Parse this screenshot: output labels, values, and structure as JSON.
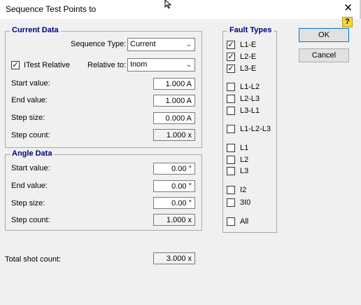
{
  "window": {
    "title": "Sequence Test Points to"
  },
  "current_data": {
    "title": "Current Data",
    "sequence_type_label": "Sequence Type:",
    "sequence_type_value": "Current",
    "itest_relative_label": "ITest Relative",
    "itest_relative_checked": true,
    "relative_to_label": "Relative to:",
    "relative_to_value": "Inom",
    "start_label": "Start value:",
    "start_value": "1.000 A",
    "end_label": "End value:",
    "end_value": "1.000 A",
    "step_size_label": "Step size:",
    "step_size_value": "0.000 A",
    "step_count_label": "Step count:",
    "step_count_value": "1.000 x"
  },
  "angle_data": {
    "title": "Angle Data",
    "start_label": "Start value:",
    "start_value": "0.00 °",
    "end_label": "End value:",
    "end_value": "0.00 °",
    "step_size_label": "Step size:",
    "step_size_value": "0.00 °",
    "step_count_label": "Step count:",
    "step_count_value": "1.000 x"
  },
  "total": {
    "label": "Total shot count:",
    "value": "3.000 x"
  },
  "fault_types": {
    "title": "Fault Types",
    "items": [
      {
        "label": "L1-E",
        "checked": true
      },
      {
        "label": "L2-E",
        "checked": true
      },
      {
        "label": "L3-E",
        "checked": true
      },
      {
        "label": "L1-L2",
        "checked": false
      },
      {
        "label": "L2-L3",
        "checked": false
      },
      {
        "label": "L3-L1",
        "checked": false
      },
      {
        "label": "L1-L2-L3",
        "checked": false
      },
      {
        "label": "L1",
        "checked": false
      },
      {
        "label": "L2",
        "checked": false
      },
      {
        "label": "L3",
        "checked": false
      },
      {
        "label": "I2",
        "checked": false
      },
      {
        "label": "3I0",
        "checked": false
      },
      {
        "label": "All",
        "checked": false
      }
    ]
  },
  "buttons": {
    "ok": "OK",
    "cancel": "Cancel",
    "help": "?",
    "close": "✕"
  }
}
